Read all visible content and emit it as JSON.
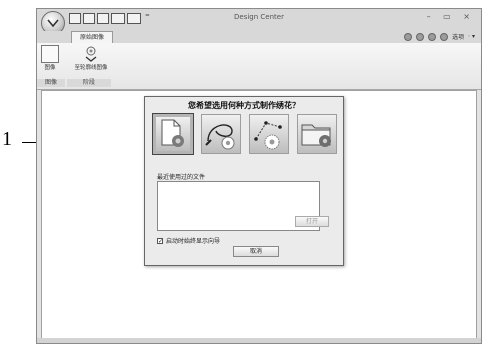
{
  "callout": {
    "number": "1"
  },
  "window": {
    "title": "Design Center",
    "controls": "– ▭ ×",
    "quick_access": {
      "extra": "⁼"
    }
  },
  "tabs": [
    {
      "label": "原始图像"
    }
  ],
  "right_toolbar": {
    "options_label": "选项"
  },
  "ribbon": {
    "buttons": [
      {
        "label": "图像"
      },
      {
        "label": "至轮廓线图像"
      }
    ],
    "group_labels": [
      "图像",
      "阶段"
    ]
  },
  "dialog": {
    "question": "您希望选用何种方式制作绣花？",
    "options": [
      {
        "name": "image-file-option",
        "icon": "document-flower-icon",
        "selected": true
      },
      {
        "name": "draw-outline-option",
        "icon": "pen-curve-flower-icon",
        "selected": false
      },
      {
        "name": "connect-points-option",
        "icon": "dotted-points-flower-icon",
        "selected": false
      },
      {
        "name": "open-file-option",
        "icon": "folder-flower-icon",
        "selected": false
      }
    ],
    "recent_label": "最近使用过的文件",
    "open_button": "打开",
    "startup_checkbox": {
      "label": "启动时始终显示向导",
      "checked": true
    },
    "cancel_button": "取消"
  },
  "colors": {
    "window_bg": "#e3e3e3",
    "dialog_bg": "#ebebeb",
    "workspace_bg": "#ffffff"
  }
}
